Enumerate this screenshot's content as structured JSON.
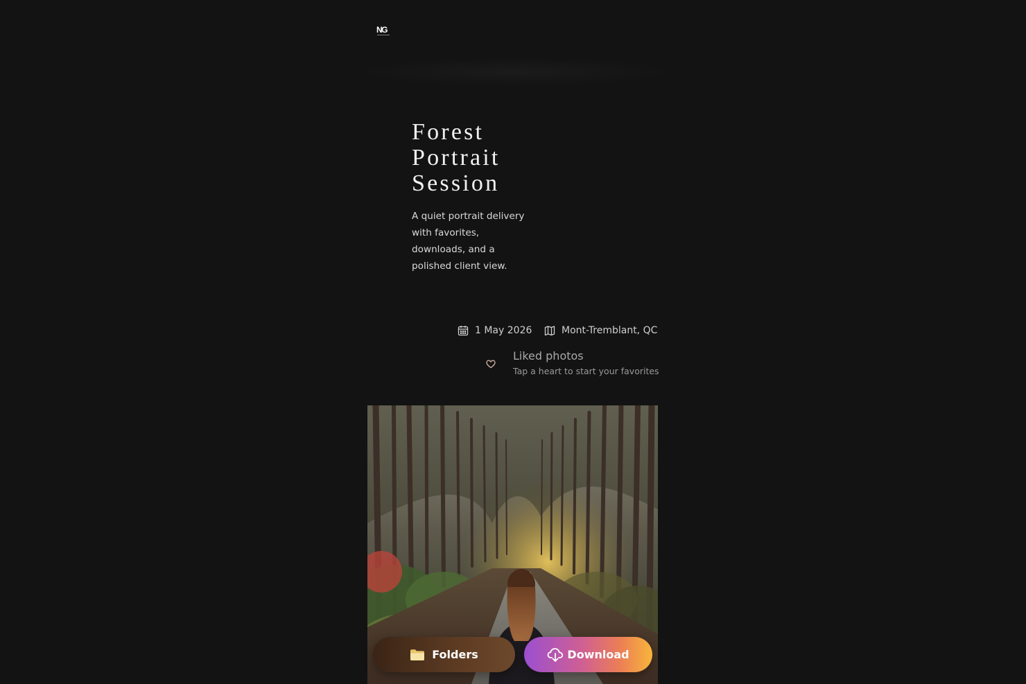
{
  "brand": {
    "logo_text": "NG"
  },
  "gallery": {
    "title": "Forest Portrait Session",
    "description": "A quiet portrait delivery with favorites, downloads, and a polished client view.",
    "date": "1 May 2026",
    "location": "Mont-Tremblant, QC"
  },
  "liked": {
    "title": "Liked photos",
    "subtitle": "Tap a heart to start your favorites"
  },
  "photo": {
    "subject": "woman-walking-forest-path"
  },
  "actions": {
    "folders_label": "Folders",
    "download_label": "Download"
  },
  "icons": {
    "date": "calendar-icon",
    "location": "map-icon",
    "liked": "heart-icon",
    "folders": "folder-icon",
    "download": "cloud-download-icon"
  },
  "colors": {
    "background": "#131313",
    "download_gradient": [
      "#9b4fd0",
      "#cf5f93",
      "#ec7f55",
      "#f7b53b"
    ],
    "folders_gradient": [
      "#3a2416",
      "#6d482b"
    ]
  }
}
